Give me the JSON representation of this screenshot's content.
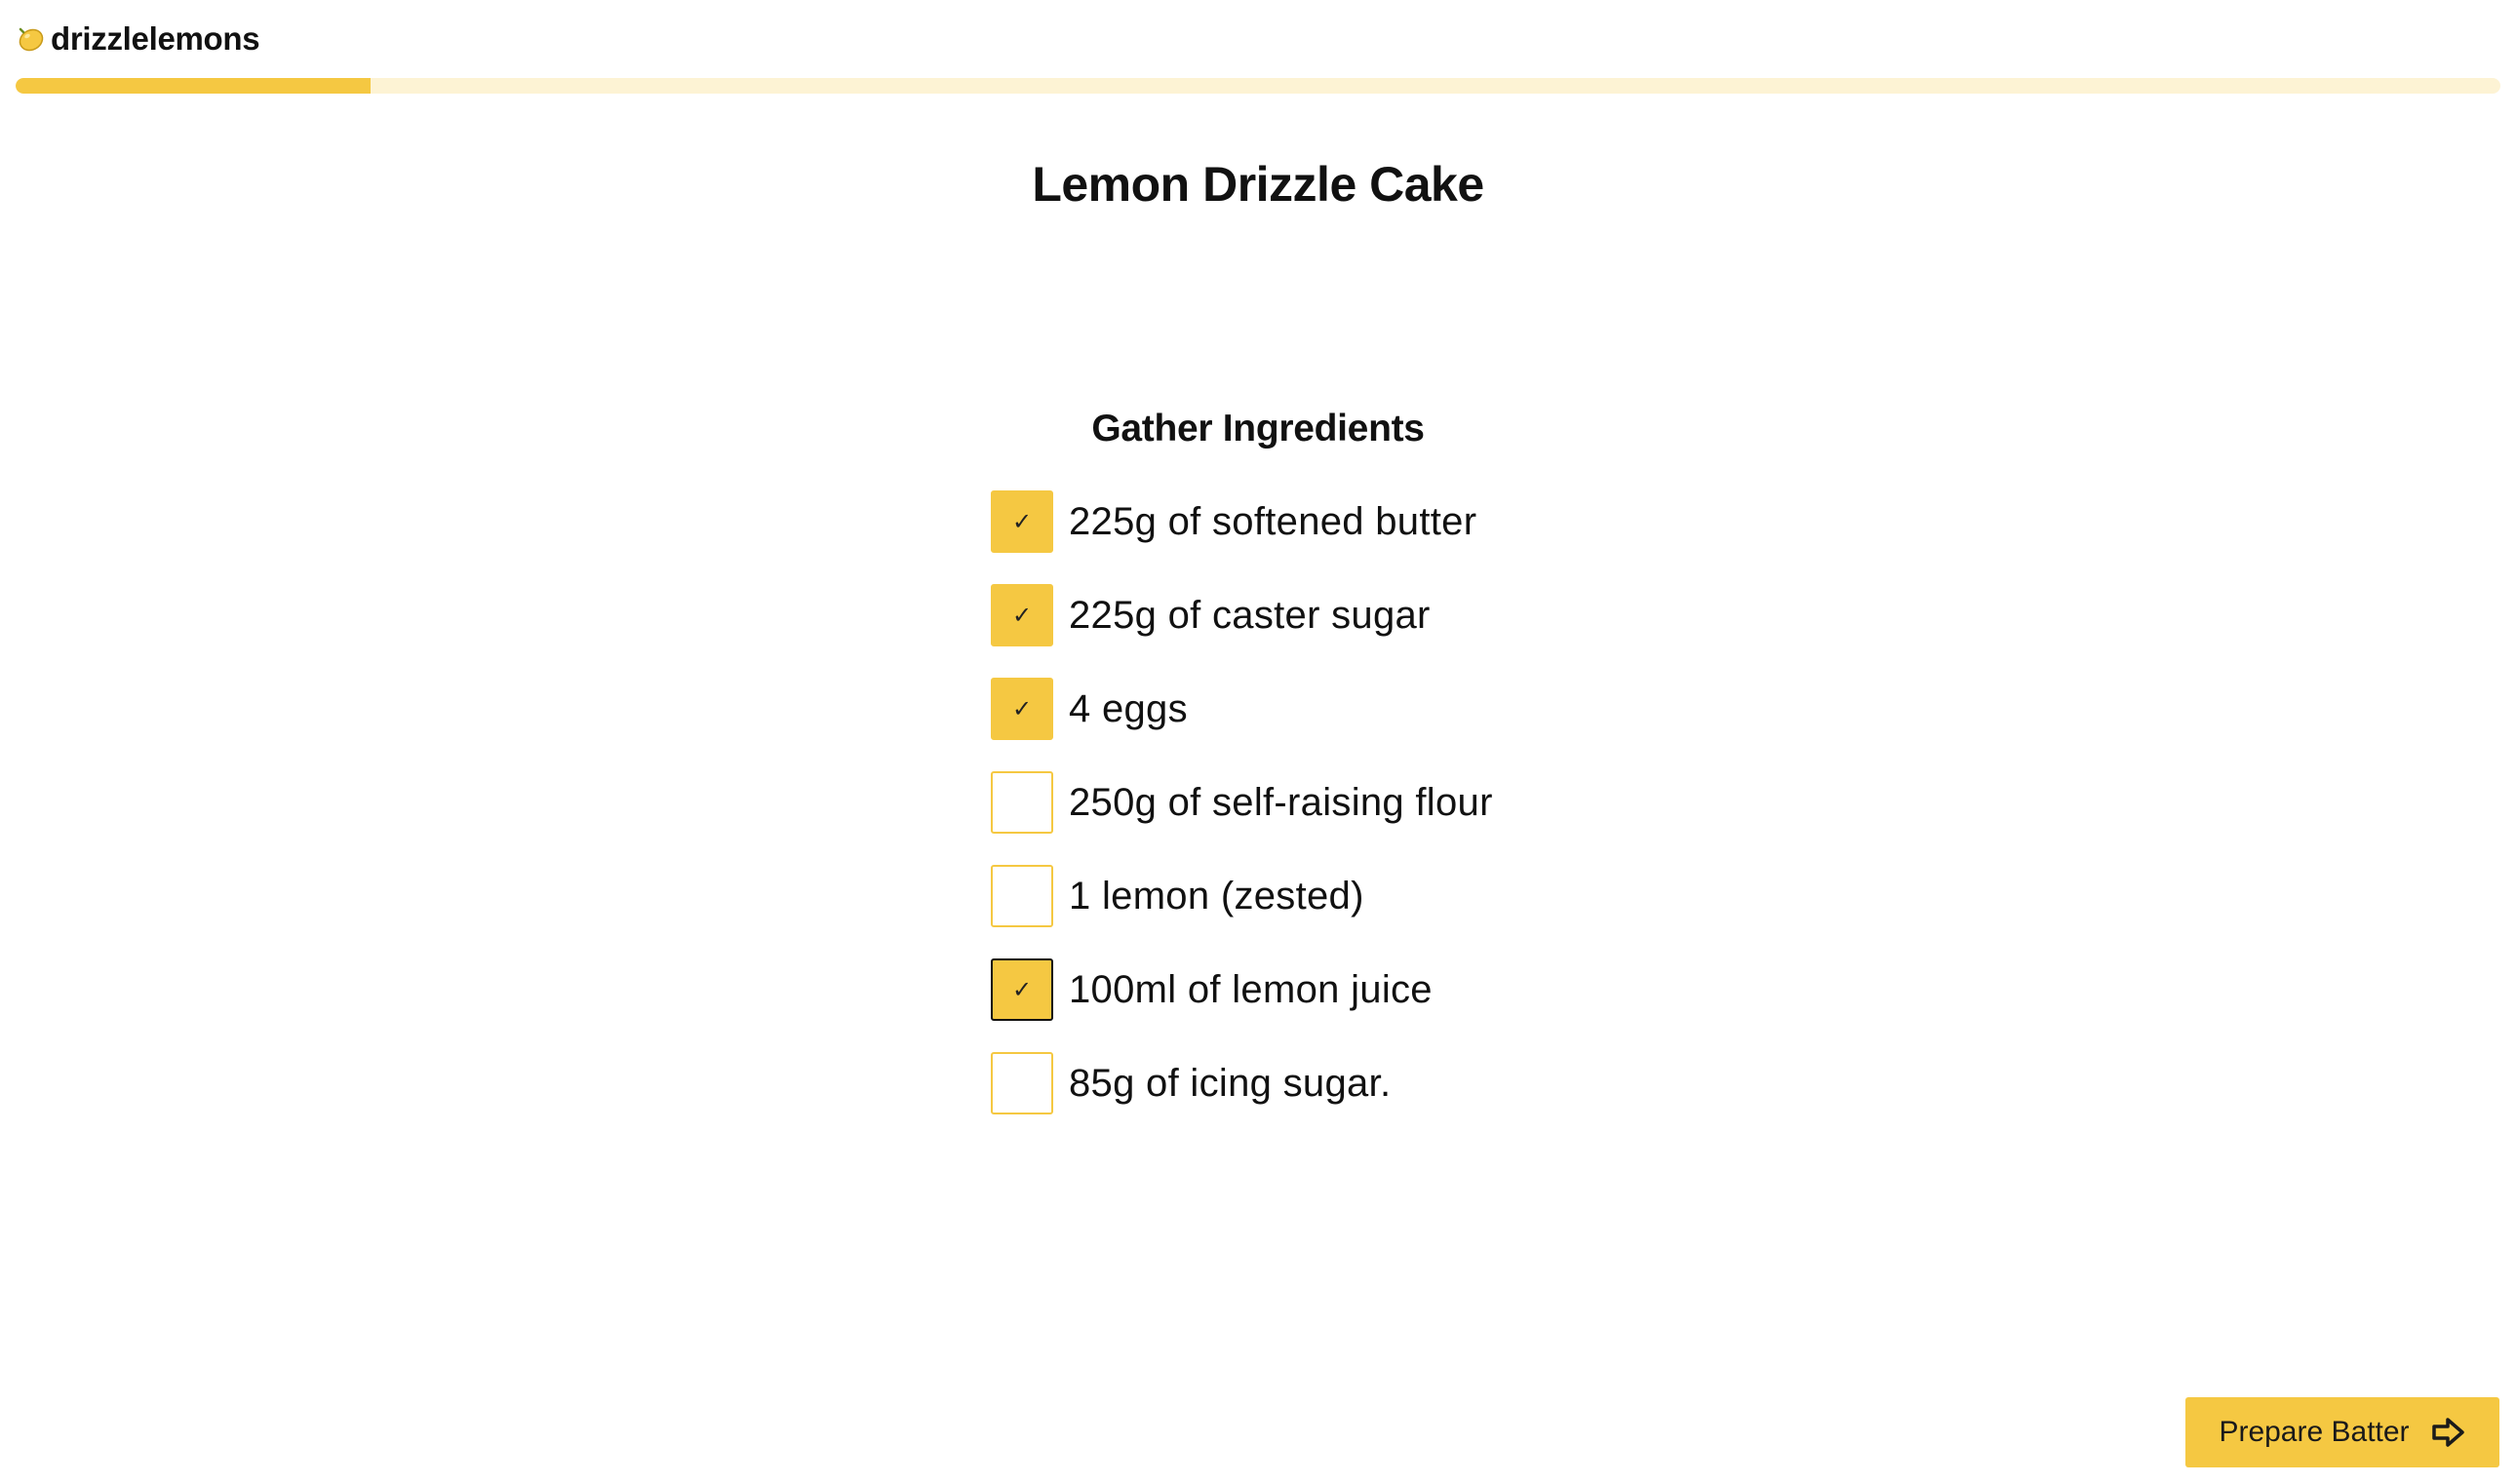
{
  "header": {
    "brand": "drizzlelemons",
    "logo_icon": "lemon-icon"
  },
  "progress": {
    "percent": 14.3
  },
  "recipe": {
    "title": "Lemon Drizzle Cake"
  },
  "section": {
    "title": "Gather Ingredients",
    "ingredients": [
      {
        "label": "225g of softened butter",
        "checked": true,
        "focused": false
      },
      {
        "label": "225g of caster sugar",
        "checked": true,
        "focused": false
      },
      {
        "label": "4 eggs",
        "checked": true,
        "focused": false
      },
      {
        "label": "250g of self-raising flour",
        "checked": false,
        "focused": false
      },
      {
        "label": "1 lemon (zested)",
        "checked": false,
        "focused": false
      },
      {
        "label": "100ml of lemon juice",
        "checked": true,
        "focused": true
      },
      {
        "label": "85g of icing sugar.",
        "checked": false,
        "focused": false
      }
    ]
  },
  "next_button": {
    "label": "Prepare Batter",
    "icon": "arrow-right-icon"
  },
  "colors": {
    "accent": "#f5c842",
    "track": "#fdf3d4",
    "text": "#111111"
  }
}
